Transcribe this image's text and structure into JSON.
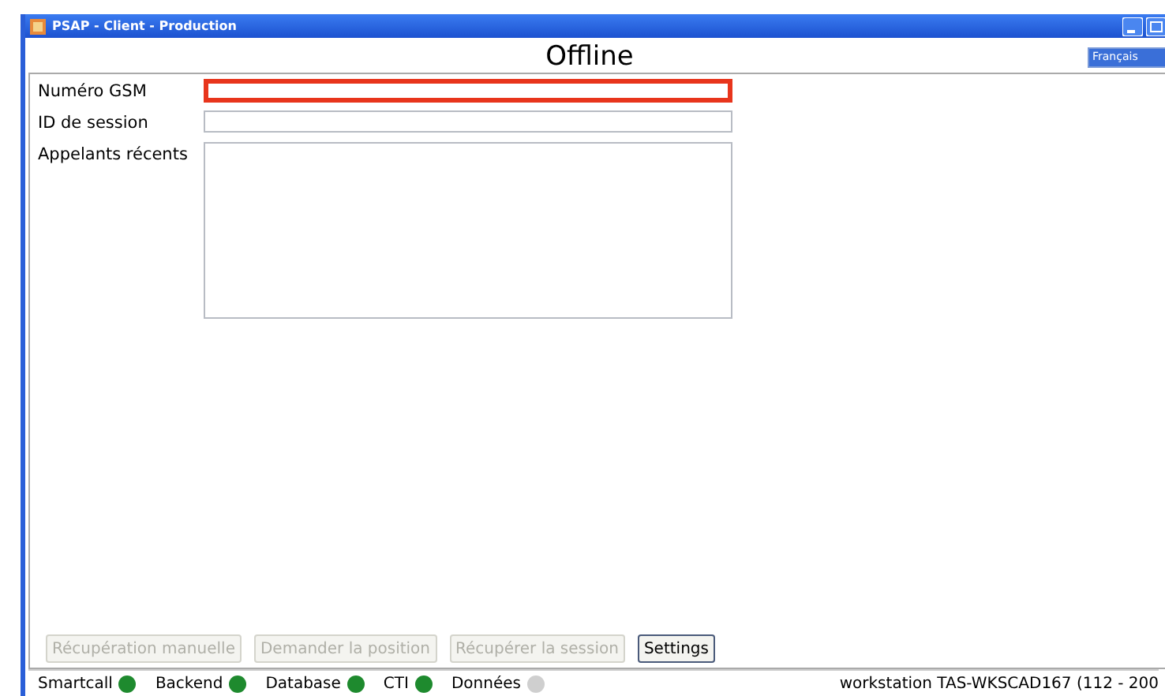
{
  "window": {
    "title": "PSAP - Client - Production"
  },
  "heading": "Offline",
  "language": {
    "value": "Français"
  },
  "fields": [
    {
      "label": "Numéro GSM",
      "kind": "input",
      "highlighted": true
    },
    {
      "label": "ID de session",
      "kind": "input",
      "highlighted": false
    },
    {
      "label": "Appelants récents",
      "kind": "list",
      "highlighted": false
    }
  ],
  "buttons": [
    {
      "label": "Récupération manuelle",
      "disabled": true
    },
    {
      "label": "Demander la position",
      "disabled": true
    },
    {
      "label": "Récupérer la session",
      "disabled": true
    },
    {
      "label": "Settings",
      "disabled": false
    }
  ],
  "status_bar": {
    "items": [
      {
        "label": "Smartcall",
        "color": "#1e8a2e"
      },
      {
        "label": "Backend",
        "color": "#1e8a2e"
      },
      {
        "label": "Database",
        "color": "#1e8a2e"
      },
      {
        "label": "CTI",
        "color": "#1e8a2e"
      },
      {
        "label": "Données",
        "color": "#cfcfcf"
      }
    ],
    "workstation": "workstation TAS-WKSCAD167 (112 - 200"
  }
}
